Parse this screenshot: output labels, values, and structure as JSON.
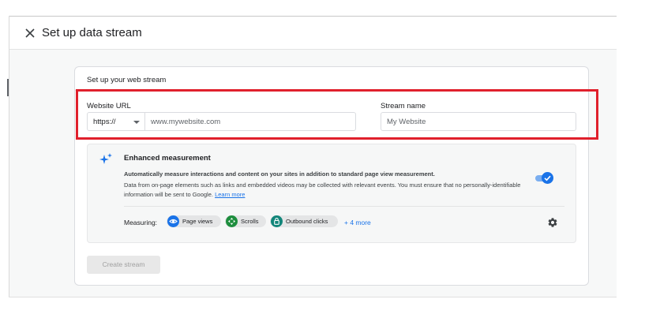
{
  "header": {
    "title": "Set up data stream",
    "close_icon": "close-icon"
  },
  "card": {
    "title": "Set up your web stream",
    "website_url": {
      "label": "Website URL",
      "protocol_value": "https://",
      "placeholder": "www.mywebsite.com"
    },
    "stream_name": {
      "label": "Stream name",
      "placeholder": "My Website"
    }
  },
  "enhanced_measurement": {
    "icon": "sparkle-icon",
    "title": "Enhanced measurement",
    "description": "Automatically measure interactions and content on your sites in addition to standard page view measurement.",
    "note": "Data from on-page elements such as links and embedded videos may be collected with relevant events. You must ensure that no personally-identifiable information will be sent to Google.",
    "learn_more": "Learn more",
    "toggle_enabled": true,
    "measuring_label": "Measuring:",
    "chips": [
      {
        "label": "Page views",
        "icon": "eye-icon",
        "color": "#1a73e8"
      },
      {
        "label": "Scrolls",
        "icon": "scroll-arrows-icon",
        "color": "#1e8e3e"
      },
      {
        "label": "Outbound clicks",
        "icon": "lock-icon",
        "color": "#12867a"
      }
    ],
    "more_link": "+ 4 more",
    "settings_icon": "gear-icon"
  },
  "actions": {
    "create_stream": "Create stream"
  },
  "colors": {
    "accent": "#1a73e8",
    "highlight": "#e0202c",
    "toggle_track": "#7aaef0",
    "disabled_button_bg": "#e8e8e8"
  }
}
